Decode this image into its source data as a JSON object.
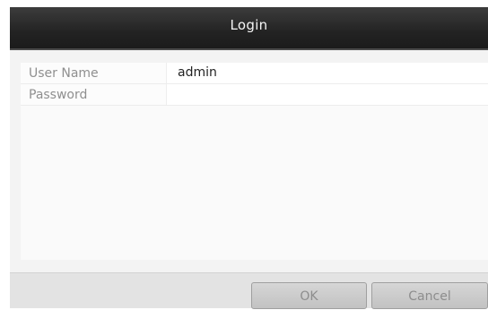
{
  "dialog": {
    "title": "Login"
  },
  "form": {
    "user_name_label": "User Name",
    "user_name_value": "admin",
    "password_label": "Password",
    "password_value": ""
  },
  "buttons": {
    "ok_label": "OK",
    "cancel_label": "Cancel"
  }
}
